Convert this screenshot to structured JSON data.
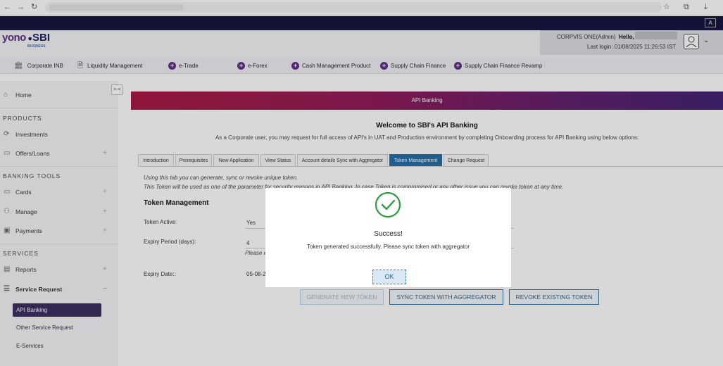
{
  "browser": {
    "back": "←",
    "forward": "→",
    "reload": "↻",
    "star": "☆",
    "ext": "⧉",
    "download": "⤓",
    "menu": "⋮"
  },
  "topstrip": {
    "aa_label": "A"
  },
  "logo": {
    "yono": "yono",
    "sbi": "SBI",
    "business": "BUSINESS"
  },
  "user": {
    "name": "CORPVIS ONE(Admin)",
    "hello": "Hello,",
    "last_login": "Last login: 01/08/2025 11:26:53 IST"
  },
  "menubar": {
    "items": [
      "Corporate INB",
      "Liquidity Management",
      "e-Trade",
      "e-Forex",
      "Cash Management Product",
      "Supply Chain Finance",
      "Supply Chain Finance Revamp"
    ]
  },
  "sidebar": {
    "home": "Home",
    "products_heading": "PRODUCTS",
    "investments": "Investments",
    "offers_loans": "Offers/Loans",
    "banking_tools_heading": "BANKING TOOLS",
    "cards": "Cards",
    "manage": "Manage",
    "payments": "Payments",
    "services_heading": "SERVICES",
    "reports": "Reports",
    "service_request": "Service Request",
    "sub": [
      "API Banking",
      "Other Service Request",
      "E-Services"
    ]
  },
  "main": {
    "banner": "API Banking",
    "welcome": "Welcome to SBI's API Banking",
    "intro": "As a Corporate user, you may request for full access of API's in UAT and Production environment by completing Onboarding process for API Banking using below options:",
    "tabs": [
      "Introduction",
      "Prerequisites",
      "New Application",
      "View Status",
      "Account details Sync with Aggregator",
      "Token Management",
      "Change Request"
    ],
    "info1": "Using this tab you can generate, sync or revoke unique token.",
    "info2": "This Token will be used as one of the parameter for security reasons in API Banking. In case Token is compromised or any other issue you can revoke token at any time.",
    "section_title": "Token Management",
    "token_active_label": "Token Active:",
    "token_active_value": "Yes",
    "expiry_period_label": "Expiry Period (days):",
    "expiry_period_value": "4",
    "expiry_note": "Please e",
    "expiry_date_label": "Expiry Date::",
    "expiry_date_value": "05-08-2",
    "buttons": {
      "generate": "GENERATE NEW TOKEN",
      "sync": "SYNC TOKEN WITH AGGREGATOR",
      "revoke": "REVOKE EXISTING TOKEN"
    }
  },
  "modal": {
    "title": "Success!",
    "message": "Token generated successfully. Please sync token with aggregator",
    "ok": "OK"
  },
  "colors": {
    "accent": "#1e6aa6",
    "sidebar_active": "#37285e",
    "brand_purple": "#5b2a86",
    "success": "#2e9a3b"
  }
}
